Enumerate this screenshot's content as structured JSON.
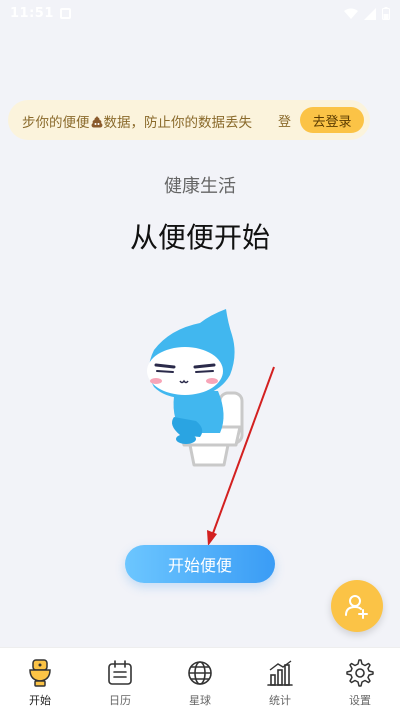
{
  "status_bar": {
    "time": "11:51"
  },
  "banner": {
    "text_before": "步你的便便",
    "text_after": "数据，防止你的数据丢失",
    "clipped": "登",
    "login_label": "去登录"
  },
  "hero": {
    "subtitle": "健康生活",
    "headline": "从便便开始"
  },
  "start_button": {
    "label": "开始便便"
  },
  "tabs": [
    {
      "label": "开始",
      "icon": "toilet-icon",
      "active": true
    },
    {
      "label": "日历",
      "icon": "calendar-icon",
      "active": false
    },
    {
      "label": "星球",
      "icon": "globe-icon",
      "active": false
    },
    {
      "label": "统计",
      "icon": "chart-icon",
      "active": false
    },
    {
      "label": "设置",
      "icon": "gear-icon",
      "active": false
    }
  ],
  "colors": {
    "accent_yellow": "#fbc346",
    "button_blue": "#3a9cf5",
    "arrow_red": "#d32020"
  }
}
